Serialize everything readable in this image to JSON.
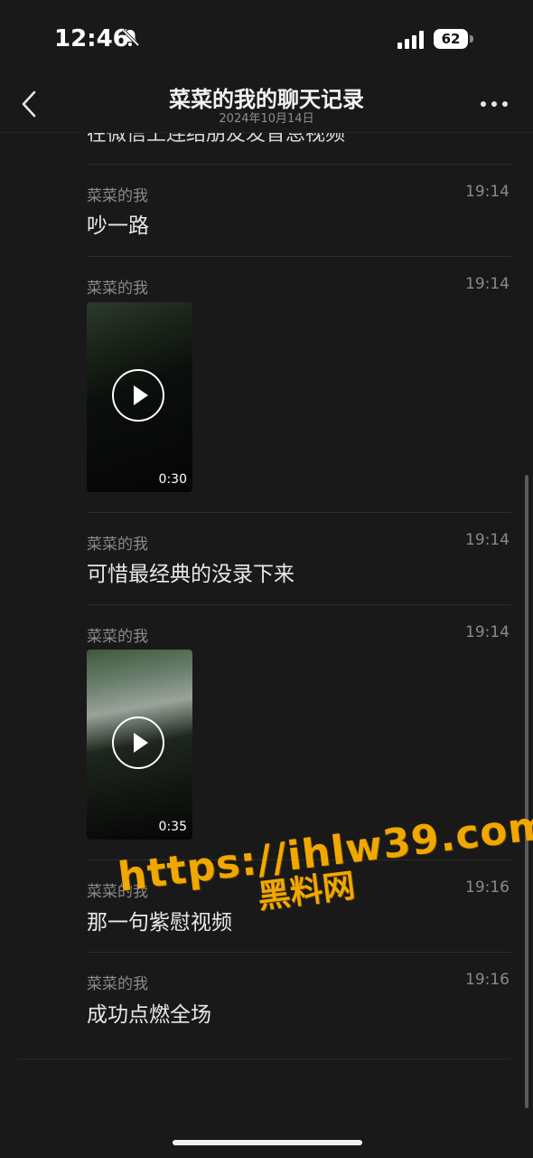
{
  "status_bar": {
    "time": "12:46",
    "battery": "62"
  },
  "nav": {
    "title": "菜菜的我的聊天记录",
    "subtitle": "2024年10月14日"
  },
  "prev_partial_text": "在微信上连结朋友发音息视频",
  "messages": [
    {
      "type": "text",
      "sender": "菜菜的我",
      "time": "19:14",
      "text": "吵一路"
    },
    {
      "type": "video",
      "sender": "菜菜的我",
      "time": "19:14",
      "duration": "0:30"
    },
    {
      "type": "text",
      "sender": "菜菜的我",
      "time": "19:14",
      "text": "可惜最经典的没录下来"
    },
    {
      "type": "video",
      "sender": "菜菜的我",
      "time": "19:14",
      "duration": "0:35"
    },
    {
      "type": "text",
      "sender": "菜菜的我",
      "time": "19:16",
      "text": "那一句紫慰视频"
    },
    {
      "type": "text",
      "sender": "菜菜的我",
      "time": "19:16",
      "text": "成功点燃全场"
    }
  ],
  "watermark": {
    "line1": "https://ihlw39.com",
    "line2": "黑料网"
  },
  "colors": {
    "background": "#191919",
    "watermark": "#f0a800"
  }
}
